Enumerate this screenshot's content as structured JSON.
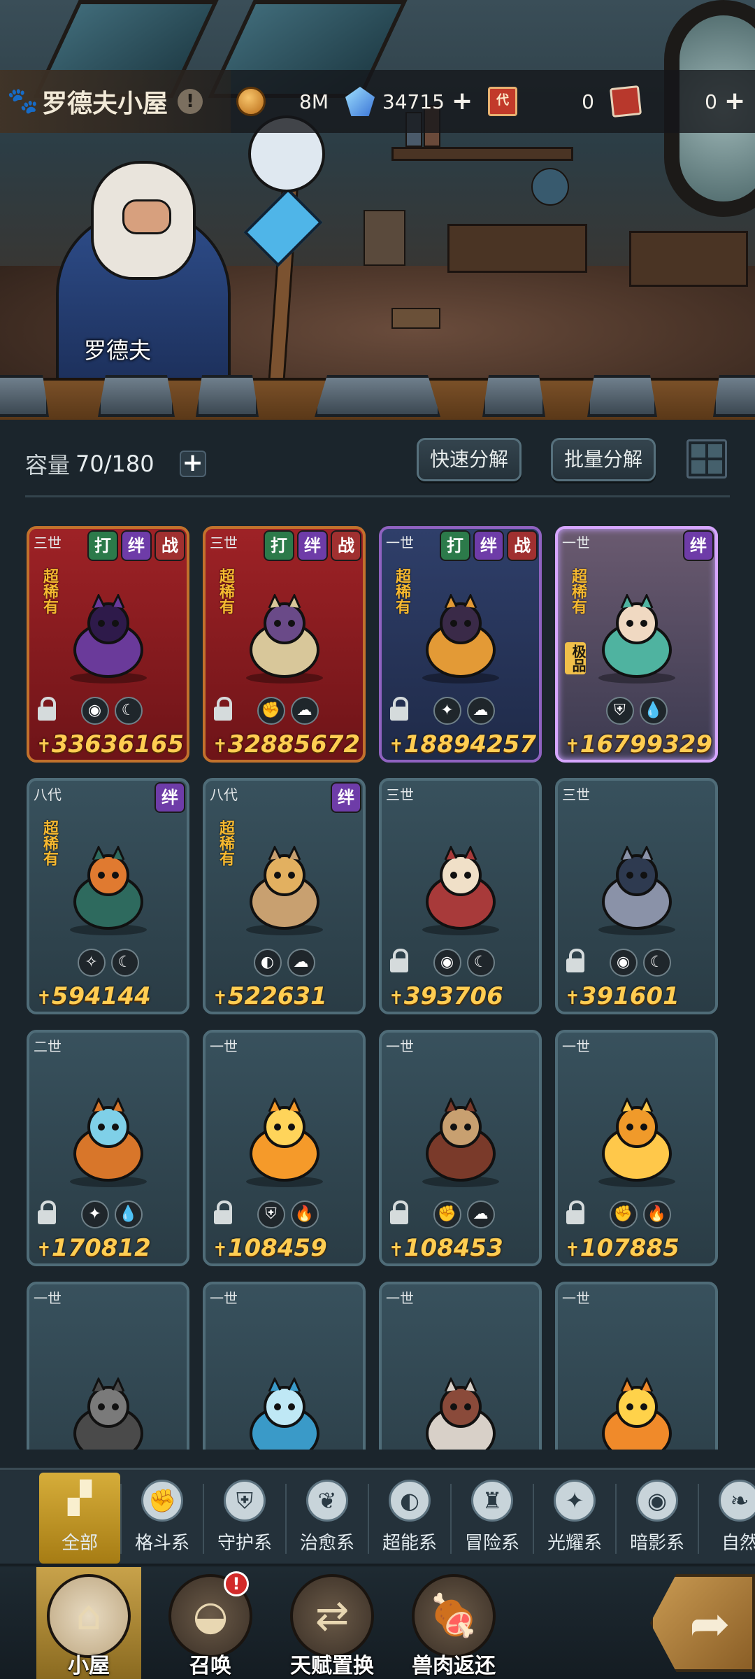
{
  "home": {
    "title": "罗德夫小屋",
    "info": "!"
  },
  "resources": [
    {
      "icon": "gold-coin-icon",
      "value": "8M"
    },
    {
      "icon": "blue-crystal-icon",
      "value": "34715"
    },
    {
      "icon": "red-ticket-icon",
      "value": "0",
      "ticket_text": "代"
    },
    {
      "icon": "scroll-ticket-icon",
      "value": "0"
    }
  ],
  "npc": {
    "name": "罗德夫"
  },
  "capacity": {
    "label": "容量",
    "value": "70/180"
  },
  "actions": {
    "quick_decompose": "快速分解",
    "batch_decompose": "批量分解"
  },
  "cards": [
    {
      "gen": "三世",
      "tags": [
        "打",
        "绊",
        "战"
      ],
      "rarity": "超稀有",
      "grade": "",
      "elements": [
        "◉",
        "☾"
      ],
      "locked": true,
      "power": "33636165",
      "style": "red"
    },
    {
      "gen": "三世",
      "tags": [
        "打",
        "绊",
        "战"
      ],
      "rarity": "超稀有",
      "grade": "",
      "elements": [
        "✊",
        "☁"
      ],
      "locked": true,
      "power": "32885672",
      "style": "red"
    },
    {
      "gen": "一世",
      "tags": [
        "打",
        "绊",
        "战"
      ],
      "rarity": "超稀有",
      "grade": "",
      "elements": [
        "✦",
        "☁"
      ],
      "locked": true,
      "power": "18894257",
      "style": "blue"
    },
    {
      "gen": "一世",
      "tags": [
        "绊"
      ],
      "rarity": "超稀有",
      "grade": "极品",
      "elements": [
        "⛨",
        "💧"
      ],
      "locked": false,
      "power": "16799329",
      "style": "gold"
    },
    {
      "gen": "八代",
      "tags": [
        "绊"
      ],
      "rarity": "超稀有",
      "grade": "",
      "elements": [
        "✧",
        "☾"
      ],
      "locked": false,
      "power": "594144",
      "style": "plain"
    },
    {
      "gen": "八代",
      "tags": [
        "绊"
      ],
      "rarity": "超稀有",
      "grade": "",
      "elements": [
        "◐",
        "☁"
      ],
      "locked": false,
      "power": "522631",
      "style": "plain"
    },
    {
      "gen": "三世",
      "tags": [],
      "rarity": "",
      "grade": "",
      "elements": [
        "◉",
        "☾"
      ],
      "locked": true,
      "power": "393706",
      "style": "plain"
    },
    {
      "gen": "三世",
      "tags": [],
      "rarity": "",
      "grade": "",
      "elements": [
        "◉",
        "☾"
      ],
      "locked": true,
      "power": "391601",
      "style": "plain"
    },
    {
      "gen": "二世",
      "tags": [],
      "rarity": "",
      "grade": "",
      "elements": [
        "✦",
        "💧"
      ],
      "locked": true,
      "power": "170812",
      "style": "plain"
    },
    {
      "gen": "一世",
      "tags": [],
      "rarity": "",
      "grade": "",
      "elements": [
        "⛨",
        "🔥"
      ],
      "locked": true,
      "power": "108459",
      "style": "plain"
    },
    {
      "gen": "一世",
      "tags": [],
      "rarity": "",
      "grade": "",
      "elements": [
        "✊",
        "☁"
      ],
      "locked": true,
      "power": "108453",
      "style": "plain"
    },
    {
      "gen": "一世",
      "tags": [],
      "rarity": "",
      "grade": "",
      "elements": [
        "✊",
        "🔥"
      ],
      "locked": true,
      "power": "107885",
      "style": "plain"
    },
    {
      "gen": "一世",
      "tags": [],
      "rarity": "",
      "grade": "",
      "elements": [],
      "locked": false,
      "power": "",
      "style": "plain"
    },
    {
      "gen": "一世",
      "tags": [],
      "rarity": "",
      "grade": "",
      "elements": [],
      "locked": false,
      "power": "",
      "style": "plain"
    },
    {
      "gen": "一世",
      "tags": [],
      "rarity": "",
      "grade": "",
      "elements": [],
      "locked": false,
      "power": "",
      "style": "plain"
    },
    {
      "gen": "一世",
      "tags": [],
      "rarity": "",
      "grade": "",
      "elements": [],
      "locked": false,
      "power": "",
      "style": "plain"
    }
  ],
  "categories": [
    {
      "label": "全部",
      "icon": "all-blocks-icon",
      "glyph": "▞",
      "active": true
    },
    {
      "label": "格斗系",
      "icon": "fist-icon",
      "glyph": "✊"
    },
    {
      "label": "守护系",
      "icon": "shield-icon",
      "glyph": "⛨"
    },
    {
      "label": "治愈系",
      "icon": "leaf-icon",
      "glyph": "❦"
    },
    {
      "label": "超能系",
      "icon": "alien-icon",
      "glyph": "◐"
    },
    {
      "label": "冒险系",
      "icon": "lantern-icon",
      "glyph": "♜"
    },
    {
      "label": "光耀系",
      "icon": "star-cross-icon",
      "glyph": "✦"
    },
    {
      "label": "暗影系",
      "icon": "eye-icon",
      "glyph": "◉"
    },
    {
      "label": "自然",
      "icon": "nature-icon",
      "glyph": "❧"
    }
  ],
  "nav": [
    {
      "label": "小屋",
      "icon": "house-icon",
      "glyph": "⌂",
      "active": true,
      "badge": ""
    },
    {
      "label": "召唤",
      "icon": "egg-icon",
      "glyph": "◒",
      "active": false,
      "badge": "!"
    },
    {
      "label": "天赋置换",
      "icon": "swap-arrows-icon",
      "glyph": "⇄",
      "active": false,
      "badge": ""
    },
    {
      "label": "兽肉返还",
      "icon": "meat-icon",
      "glyph": "🍖",
      "active": false,
      "badge": ""
    }
  ],
  "colors": {
    "gold_text": "#ffcd52",
    "rarity_text": "#f5b830",
    "panel": "#1b252c"
  }
}
